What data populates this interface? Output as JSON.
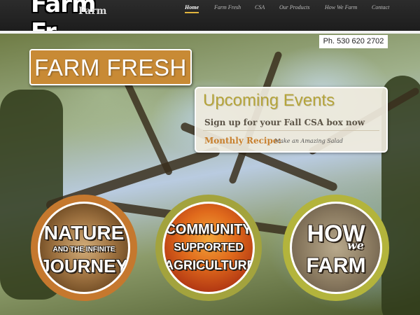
{
  "header": {
    "logo_word": "Farm Fr",
    "logo_sub": "Farm",
    "nav": [
      {
        "label": "Home",
        "active": true
      },
      {
        "label": "Farm Fresh",
        "active": false
      },
      {
        "label": "CSA",
        "active": false
      },
      {
        "label": "Our Products",
        "active": false
      },
      {
        "label": "How We Farm",
        "active": false
      },
      {
        "label": "Contact",
        "active": false
      }
    ]
  },
  "hero": {
    "phone": "Ph. 530 620 2702",
    "banner": "FARM FRESH",
    "events": {
      "title": "Upcoming Events",
      "line1": "Sign up for your Fall CSA box now",
      "recipe_label": "Monthly Recipe:",
      "recipe_text": "Make an Amazing Salad"
    },
    "circles": [
      {
        "lines": [
          "NATURE",
          "AND THE INFINITE",
          "JOURNEY"
        ]
      },
      {
        "lines": [
          "COMMUNITY",
          "SUPPORTED",
          "AGRICULTURE"
        ]
      },
      {
        "lines": [
          "HOW",
          "we",
          "FARM"
        ]
      }
    ]
  },
  "colors": {
    "accent_gold": "#e1b53e",
    "banner_orange": "#c88a35",
    "events_title": "#b5a43a",
    "recipe_label": "#c8802e",
    "circle1_ring": "#c5782e",
    "circle2_ring": "#a3a33d",
    "circle3_ring": "#b3b43c"
  }
}
